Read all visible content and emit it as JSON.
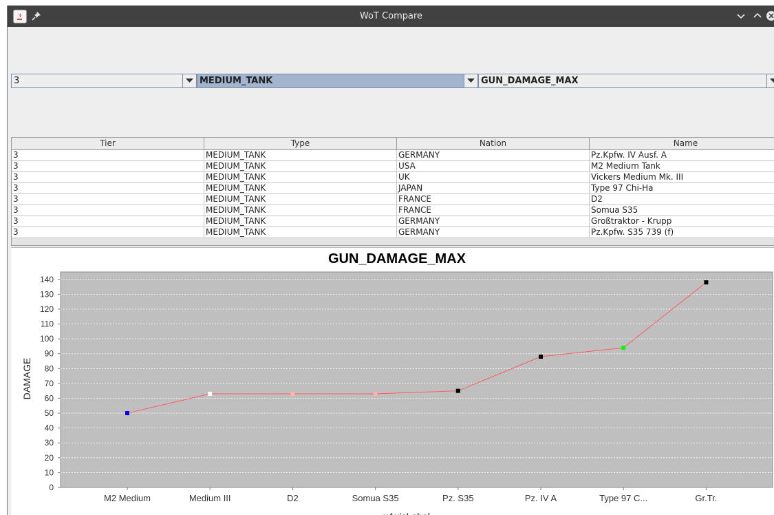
{
  "window": {
    "title": "WoT Compare"
  },
  "filters": {
    "tier": "3",
    "type": "MEDIUM_TANK",
    "stat": "GUN_DAMAGE_MAX"
  },
  "table": {
    "columns": [
      "Tier",
      "Type",
      "Nation",
      "Name"
    ],
    "rows": [
      [
        "3",
        "MEDIUM_TANK",
        "GERMANY",
        "Pz.Kpfw. IV Ausf. A"
      ],
      [
        "3",
        "MEDIUM_TANK",
        "USA",
        "M2 Medium Tank"
      ],
      [
        "3",
        "MEDIUM_TANK",
        "UK",
        "Vickers Medium Mk. III"
      ],
      [
        "3",
        "MEDIUM_TANK",
        "JAPAN",
        "Type 97 Chi-Ha"
      ],
      [
        "3",
        "MEDIUM_TANK",
        "FRANCE",
        "D2"
      ],
      [
        "3",
        "MEDIUM_TANK",
        "FRANCE",
        "Somua S35"
      ],
      [
        "3",
        "MEDIUM_TANK",
        "GERMANY",
        "Großtraktor - Krupp"
      ],
      [
        "3",
        "MEDIUM_TANK",
        "GERMANY",
        "Pz.Kpfw. S35 739 (f)"
      ]
    ]
  },
  "chart_data": {
    "type": "line",
    "title": "GUN_DAMAGE_MAX",
    "xlabel": "xAxisLabel",
    "ylabel": "DAMAGE",
    "ylim": [
      0,
      145
    ],
    "yticks": [
      0,
      10,
      20,
      30,
      40,
      50,
      60,
      70,
      80,
      90,
      100,
      110,
      120,
      130,
      140
    ],
    "grid": true,
    "legend": "none",
    "categories": [
      "M2 Medium",
      "Medium III",
      "D2",
      "Somua S35",
      "Pz. S35",
      "Pz. IV A",
      "Type 97 C...",
      "Gr.Tr."
    ],
    "values": [
      50,
      63,
      63,
      63,
      65,
      88,
      94,
      138
    ],
    "point_colors": [
      "#0000ff",
      "#ffffff",
      "#ffb0b0",
      "#ffb0b0",
      "#000000",
      "#000000",
      "#00ff00",
      "#000000"
    ],
    "line_color": "#ff5a5a",
    "plot_background": "#bfbfbf"
  }
}
